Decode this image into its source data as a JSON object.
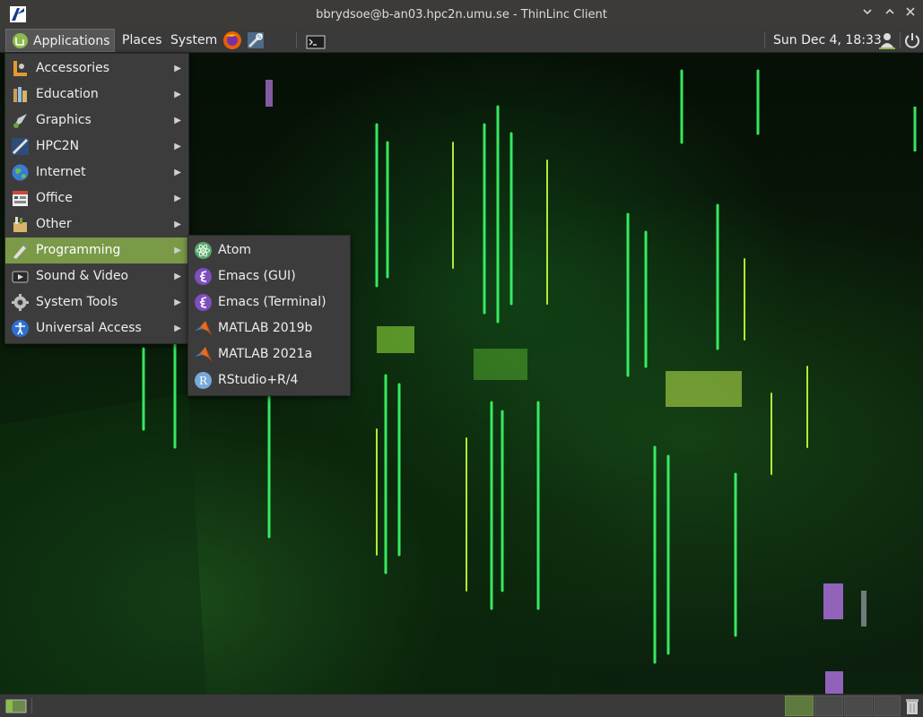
{
  "window": {
    "title": "bbrydsoe@b-an03.hpc2n.umu.se - ThinLinc Client",
    "controls": [
      "minimize",
      "maximize",
      "close"
    ]
  },
  "panel": {
    "applications_label": "Applications",
    "places_label": "Places",
    "system_label": "System",
    "clock": "Sun Dec  4, 18:33",
    "launchers": [
      "firefox-icon",
      "settings-tool-icon",
      "terminal-icon"
    ]
  },
  "applications_menu": {
    "items": [
      {
        "label": "Accessories",
        "icon": "accessories-icon"
      },
      {
        "label": "Education",
        "icon": "education-icon"
      },
      {
        "label": "Graphics",
        "icon": "graphics-icon"
      },
      {
        "label": "HPC2N",
        "icon": "hpc2n-icon"
      },
      {
        "label": "Internet",
        "icon": "internet-globe-icon"
      },
      {
        "label": "Office",
        "icon": "office-icon"
      },
      {
        "label": "Other",
        "icon": "other-icon"
      },
      {
        "label": "Programming",
        "icon": "programming-icon",
        "selected": true
      },
      {
        "label": "Sound & Video",
        "icon": "sound-video-icon"
      },
      {
        "label": "System Tools",
        "icon": "system-tools-icon"
      },
      {
        "label": "Universal Access",
        "icon": "universal-access-icon"
      }
    ]
  },
  "programming_submenu": {
    "items": [
      {
        "label": "Atom",
        "icon": "atom-icon"
      },
      {
        "label": "Emacs (GUI)",
        "icon": "emacs-icon"
      },
      {
        "label": "Emacs (Terminal)",
        "icon": "emacs-icon"
      },
      {
        "label": "MATLAB 2019b",
        "icon": "matlab-icon"
      },
      {
        "label": "MATLAB 2021a",
        "icon": "matlab-icon"
      },
      {
        "label": "RStudio+R/4",
        "icon": "rstudio-icon"
      }
    ]
  },
  "colors": {
    "menu_bg": "#3c3c3c",
    "highlight": "#7a9a48",
    "panel_bg": "#3a3a3a"
  }
}
